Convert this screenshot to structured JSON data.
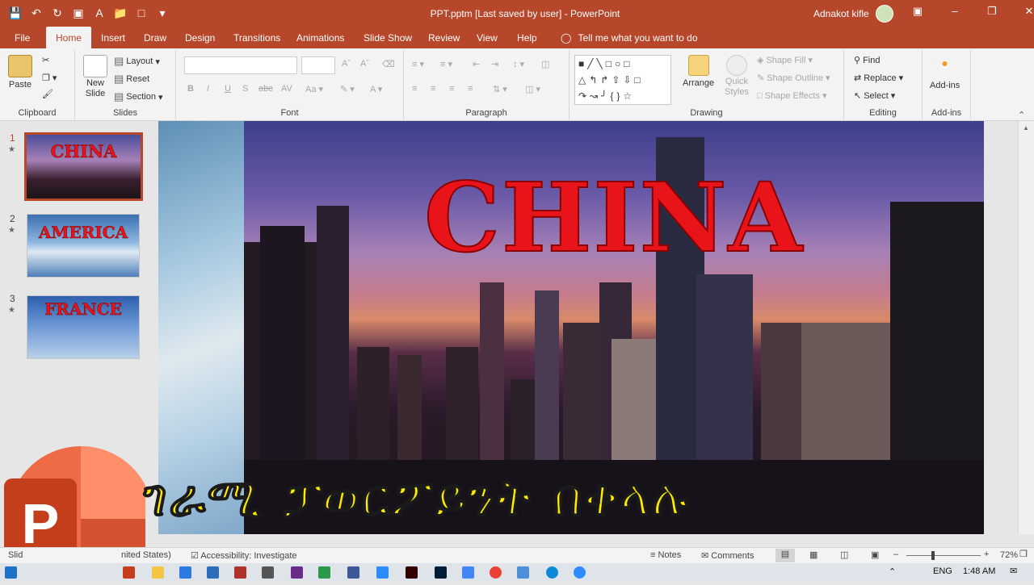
{
  "window": {
    "doc_title": "PPT.pptm [Last saved by user]  -  PowerPoint",
    "user_name": "Adnakot kifle"
  },
  "tabs": [
    "File",
    "Home",
    "Insert",
    "Draw",
    "Design",
    "Transitions",
    "Animations",
    "Slide Show",
    "Review",
    "View",
    "Help"
  ],
  "tell_me": "Tell me what you want to do",
  "ribbon": {
    "clipboard": {
      "paste": "Paste",
      "label": "Clipboard"
    },
    "slides": {
      "new_slide": "New",
      "new_slide2": "Slide",
      "layout": "Layout",
      "reset": "Reset",
      "section": "Section",
      "label": "Slides"
    },
    "font": {
      "label": "Font"
    },
    "paragraph": {
      "label": "Paragraph"
    },
    "drawing": {
      "arrange": "Arrange",
      "quick_styles": "Quick",
      "quick_styles2": "Styles",
      "shape_fill": "Shape Fill",
      "shape_outline": "Shape Outline",
      "shape_effects": "Shape Effects",
      "label": "Drawing"
    },
    "editing": {
      "find": "Find",
      "replace": "Replace",
      "select": "Select",
      "label": "Editing"
    },
    "addins": {
      "button": "Add-ins",
      "label": "Add-ins"
    }
  },
  "slides": [
    {
      "number": "1",
      "title": "CHINA"
    },
    {
      "number": "2",
      "title": "AMERICA"
    },
    {
      "number": "3",
      "title": "FRANCE"
    }
  ],
  "current_slide": {
    "title": "CHINA"
  },
  "overlay_caption": "ገራሚ ፓወርፖይንት በቀላሉ",
  "status": {
    "slide_info": "Slid",
    "language": "nited States)",
    "accessibility": "Accessibility: Investigate",
    "notes": "Notes",
    "comments": "Comments",
    "zoom": "72%"
  },
  "taskbar": {
    "lang": "ENG",
    "time": "1:48 AM"
  },
  "colors": {
    "accent": "#b7472a",
    "title_red": "#e8141a",
    "caption_yellow": "#ffeb00"
  }
}
